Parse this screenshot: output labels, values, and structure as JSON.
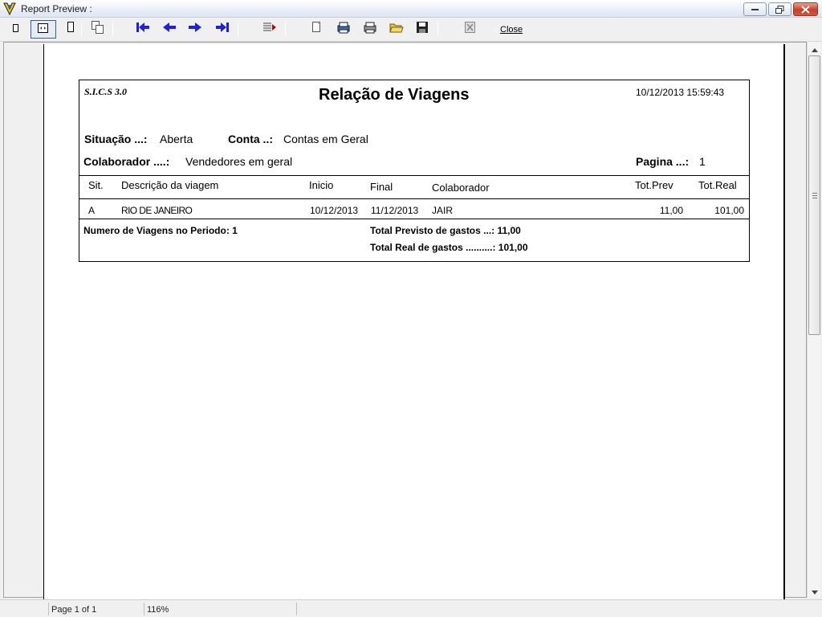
{
  "window": {
    "title": "Report Preview :"
  },
  "toolbar": {
    "close_label": "Close",
    "buttons": [
      "single-page-icon",
      "page-width-icon",
      "two-pages-icon",
      "multi-page-icon",
      "first-page-icon",
      "prior-page-icon",
      "next-page-icon",
      "last-page-icon",
      "goto-page-icon",
      "page-setup-icon",
      "printer-setup-icon",
      "print-icon",
      "open-icon",
      "save-icon",
      "cancel-icon"
    ],
    "accent_color": "#1f1fe0"
  },
  "report": {
    "system": "S.I.C.S 3.0",
    "title": "Relação de Viagens",
    "datetime": "10/12/2013 15:59:43",
    "situacao_label": "Situação ...:",
    "situacao_value": "Aberta",
    "conta_label": "Conta ..:",
    "conta_value": "Contas em Geral",
    "colaborador_label": "Colaborador ....:",
    "colaborador_value": "Vendedores em geral",
    "pagina_label": "Pagina ...:",
    "pagina_value": "1",
    "columns": {
      "sit": "Sit.",
      "descricao": "Descrição da viagem",
      "inicio": "Inicio",
      "final": "Final",
      "colaborador": "Colaborador",
      "tot_prev": "Tot.Prev",
      "tot_real": "Tot.Real"
    },
    "rows": [
      {
        "sit": "A",
        "descricao": "RIO DE JANEIRO",
        "inicio": "10/12/2013",
        "final": "11/12/2013",
        "colaborador": "JAIR",
        "tot_prev": "11,00",
        "tot_real": "101,00"
      }
    ],
    "footer": {
      "numero_viagens": "Numero de Viagens no Periodo: 1",
      "total_previsto": "Total Previsto de gastos ...: 11,00",
      "total_real": "Total Real de gastos ..........: 101,00"
    }
  },
  "status": {
    "page": "Page 1 of 1",
    "zoom": "116%"
  }
}
